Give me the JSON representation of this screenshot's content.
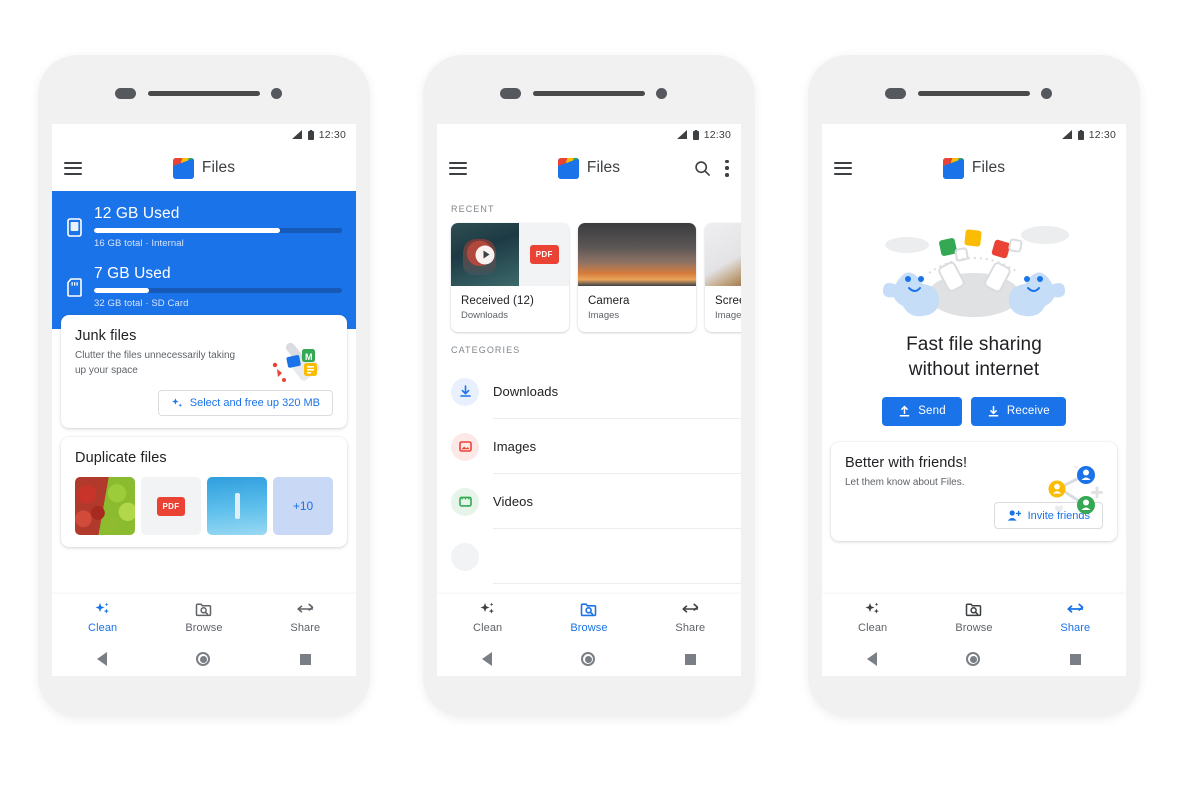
{
  "app": {
    "name": "Files",
    "logo_icon": "files-app-logo"
  },
  "status_bar": {
    "signal_icon": "signal-bars-icon",
    "battery_icon": "battery-icon",
    "time": "12:30"
  },
  "bottom_nav": {
    "items": [
      {
        "label": "Clean",
        "icon": "sparkle-icon"
      },
      {
        "label": "Browse",
        "icon": "folder-search-icon"
      },
      {
        "label": "Share",
        "icon": "share-arrows-icon"
      }
    ],
    "active_phone1": "Clean",
    "active_phone2": "Browse",
    "active_phone3": "Share"
  },
  "system_nav": {
    "back_icon": "back-triangle-icon",
    "home_icon": "home-circle-icon",
    "recents_icon": "recents-square-icon"
  },
  "colors": {
    "accent": "#1a73e8",
    "hero_blue": "#1a73e8",
    "track": "#1659b6",
    "text_primary": "#202124",
    "text_secondary": "#5f6368",
    "red": "#ea4335",
    "green": "#34a853",
    "yellow": "#fbbc04"
  },
  "phone1": {
    "menu_icon": "hamburger-menu-icon",
    "storage": [
      {
        "icon": "phone-storage-icon",
        "title": "12 GB Used",
        "subtitle": "16 GB total · Internal",
        "percent": 75
      },
      {
        "icon": "sd-card-icon",
        "title": "7 GB Used",
        "subtitle": "32 GB total · SD Card",
        "percent": 22
      }
    ],
    "junk_card": {
      "title": "Junk files",
      "description": "Clutter the files unnecessarily taking up your space",
      "action_label": "Select and free up 320 MB",
      "action_icon": "sparkle-icon",
      "illustration": "broom-and-files-illustration"
    },
    "duplicate_card": {
      "title": "Duplicate files",
      "thumbs": [
        {
          "name": "apples-photo",
          "label": ""
        },
        {
          "name": "pdf-file",
          "label": "PDF"
        },
        {
          "name": "sky-photo",
          "label": ""
        },
        {
          "name": "more-count",
          "label": "+10"
        }
      ]
    }
  },
  "phone2": {
    "menu_icon": "hamburger-menu-icon",
    "search_icon": "search-icon",
    "overflow_icon": "more-vertical-icon",
    "recent_label": "RECENT",
    "recent_files": [
      {
        "name": "Received (12)",
        "location": "Downloads",
        "thumb": "video-and-pdf-thumb",
        "badge": "PDF"
      },
      {
        "name": "Camera",
        "location": "Images",
        "thumb": "sunset-photo-thumb"
      },
      {
        "name": "Screen",
        "location": "Images",
        "thumb": "donut-photo-thumb"
      }
    ],
    "categories_label": "CATEGORIES",
    "categories": [
      {
        "name": "Downloads",
        "icon": "download-icon",
        "color": "#1a73e8"
      },
      {
        "name": "Images",
        "icon": "image-icon",
        "color": "#ea4335"
      },
      {
        "name": "Videos",
        "icon": "video-clip-icon",
        "color": "#34a853"
      }
    ]
  },
  "phone3": {
    "menu_icon": "hamburger-menu-icon",
    "hero": {
      "illustration": "two-blobs-sharing-files-illustration",
      "title_line1": "Fast file sharing",
      "title_line2": "without internet",
      "buttons": [
        {
          "label": "Send",
          "icon": "upload-icon"
        },
        {
          "label": "Receive",
          "icon": "download-icon"
        }
      ]
    },
    "friends_card": {
      "title": "Better with friends!",
      "subtitle": "Let them know about Files.",
      "action_label": "Invite friends",
      "action_icon": "person-add-icon",
      "illustration": "friends-network-illustration"
    }
  }
}
